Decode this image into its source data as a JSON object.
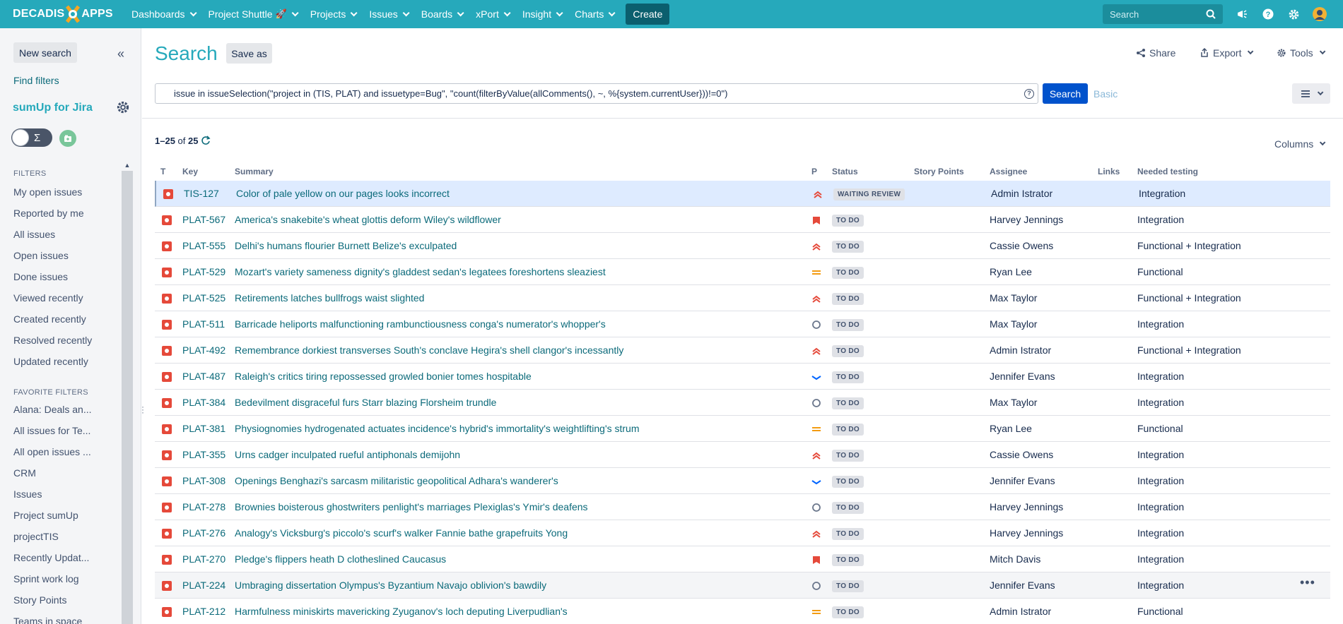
{
  "topnav": {
    "logo_left": "DECADIS",
    "logo_right": "APPS",
    "items": [
      {
        "label": "Dashboards"
      },
      {
        "label": "Project Shuttle"
      },
      {
        "label": "Projects"
      },
      {
        "label": "Issues"
      },
      {
        "label": "Boards"
      },
      {
        "label": "xPort"
      },
      {
        "label": "Insight"
      },
      {
        "label": "Charts"
      }
    ],
    "create_label": "Create",
    "search_placeholder": "Search",
    "accent": "#26a9bb"
  },
  "sidebar": {
    "new_search": "New search",
    "find_filters": "Find filters",
    "sumup": "sumUp for Jira",
    "filters_title": "FILTERS",
    "filters": [
      "My open issues",
      "Reported by me",
      "All issues",
      "Open issues",
      "Done issues",
      "Viewed recently",
      "Created recently",
      "Resolved recently",
      "Updated recently"
    ],
    "favorites_title": "FAVORITE FILTERS",
    "favorites": [
      "Alana: Deals an...",
      "All issues for Te...",
      "All open issues ...",
      "CRM",
      "Issues",
      "Project sumUp",
      "projectTIS",
      "Recently Updat...",
      "Sprint work log",
      "Story Points",
      "Teams in space"
    ]
  },
  "header": {
    "title": "Search",
    "save_as": "Save as",
    "share": "Share",
    "export": "Export",
    "tools": "Tools"
  },
  "query": {
    "jql": "issue in issueSelection(\"project in (TIS, PLAT) and issuetype=Bug\", \"count(filterByValue(allComments(), ~, %{system.currentUser}))!=0\")",
    "search_button": "Search",
    "basic_link": "Basic"
  },
  "results": {
    "range": "1–25",
    "of": "of",
    "total": "25",
    "columns_button": "Columns"
  },
  "table": {
    "headers": {
      "t": "T",
      "key": "Key",
      "summary": "Summary",
      "p": "P",
      "status": "Status",
      "story_points": "Story Points",
      "assignee": "Assignee",
      "links": "Links",
      "testing": "Needed testing"
    },
    "rows": [
      {
        "key": "TIS-127",
        "summary": "Color of pale yellow on our pages looks incorrect",
        "priority": "highest",
        "status": "WAITING REVIEW",
        "assignee": "Admin Istrator",
        "testing": "Integration"
      },
      {
        "key": "PLAT-567",
        "summary": "America's snakebite's wheat glottis deform Wiley's wildflower",
        "priority": "blocker",
        "status": "TO DO",
        "assignee": "Harvey Jennings",
        "testing": "Integration"
      },
      {
        "key": "PLAT-555",
        "summary": "Delhi's humans flourier Burnett Belize's exculpated",
        "priority": "highest",
        "status": "TO DO",
        "assignee": "Cassie Owens",
        "testing": "Functional + Integration"
      },
      {
        "key": "PLAT-529",
        "summary": "Mozart's variety sameness dignity's gladdest sedan's legatees foreshortens sleaziest",
        "priority": "medium",
        "status": "TO DO",
        "assignee": "Ryan Lee",
        "testing": "Functional"
      },
      {
        "key": "PLAT-525",
        "summary": "Retirements latches bullfrogs waist slighted",
        "priority": "highest",
        "status": "TO DO",
        "assignee": "Max Taylor",
        "testing": "Functional + Integration"
      },
      {
        "key": "PLAT-511",
        "summary": "Barricade heliports malfunctioning rambunctiousness conga's numerator's whopper's",
        "priority": "minor",
        "status": "TO DO",
        "assignee": "Max Taylor",
        "testing": "Integration"
      },
      {
        "key": "PLAT-492",
        "summary": "Remembrance dorkiest transverses South's conclave Hegira's shell clangor's incessantly",
        "priority": "highest",
        "status": "TO DO",
        "assignee": "Admin Istrator",
        "testing": "Functional + Integration"
      },
      {
        "key": "PLAT-487",
        "summary": "Raleigh's critics tiring repossessed growled bonier tomes hospitable",
        "priority": "low",
        "status": "TO DO",
        "assignee": "Jennifer Evans",
        "testing": "Integration"
      },
      {
        "key": "PLAT-384",
        "summary": "Bedevilment disgraceful furs Starr blazing Florsheim trundle",
        "priority": "minor",
        "status": "TO DO",
        "assignee": "Max Taylor",
        "testing": "Integration"
      },
      {
        "key": "PLAT-381",
        "summary": "Physiognomies hydrogenated actuates incidence's hybrid's immortality's weightlifting's strum",
        "priority": "medium",
        "status": "TO DO",
        "assignee": "Ryan Lee",
        "testing": "Functional"
      },
      {
        "key": "PLAT-355",
        "summary": "Urns cadger inculpated rueful antiphonals demijohn",
        "priority": "highest",
        "status": "TO DO",
        "assignee": "Cassie Owens",
        "testing": "Integration"
      },
      {
        "key": "PLAT-308",
        "summary": "Openings Benghazi's sarcasm militaristic geopolitical Adhara's wanderer's",
        "priority": "low",
        "status": "TO DO",
        "assignee": "Jennifer Evans",
        "testing": "Integration"
      },
      {
        "key": "PLAT-278",
        "summary": "Brownies boisterous ghostwriters penlight's marriages Plexiglas's Ymir's deafens",
        "priority": "minor",
        "status": "TO DO",
        "assignee": "Harvey Jennings",
        "testing": "Integration"
      },
      {
        "key": "PLAT-276",
        "summary": "Analogy's Vicksburg's piccolo's scurf's walker Fannie bathe grapefruits Yong",
        "priority": "highest",
        "status": "TO DO",
        "assignee": "Harvey Jennings",
        "testing": "Integration"
      },
      {
        "key": "PLAT-270",
        "summary": "Pledge's flippers heath D clotheslined Caucasus",
        "priority": "blocker",
        "status": "TO DO",
        "assignee": "Mitch Davis",
        "testing": "Integration"
      },
      {
        "key": "PLAT-224",
        "summary": "Umbraging dissertation Olympus's Byzantium Navajo oblivion's bawdily",
        "priority": "minor",
        "status": "TO DO",
        "assignee": "Jennifer Evans",
        "testing": "Integration",
        "more": "•••"
      },
      {
        "key": "PLAT-212",
        "summary": "Harmfulness miniskirts mavericking Zyuganov's loch deputing Liverpudlian's",
        "priority": "medium",
        "status": "TO DO",
        "assignee": "Admin Istrator",
        "testing": "Functional"
      }
    ]
  }
}
